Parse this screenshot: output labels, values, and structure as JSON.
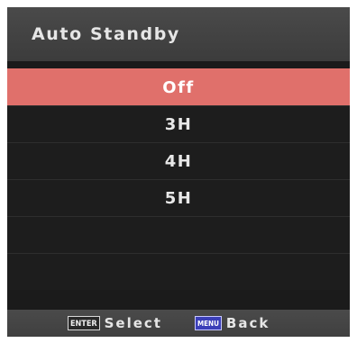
{
  "title": "Auto Standby",
  "options": [
    {
      "label": "Off",
      "selected": true
    },
    {
      "label": "3H",
      "selected": false
    },
    {
      "label": "4H",
      "selected": false
    },
    {
      "label": "5H",
      "selected": false
    },
    {
      "label": "",
      "selected": false
    },
    {
      "label": "",
      "selected": false
    }
  ],
  "footer": {
    "enter_key": "ENTER",
    "enter_label": "Select",
    "menu_key": "MENU",
    "menu_label": "Back"
  },
  "colors": {
    "selected_row": "#e0706b",
    "menu_key": "#3b3fb8"
  }
}
